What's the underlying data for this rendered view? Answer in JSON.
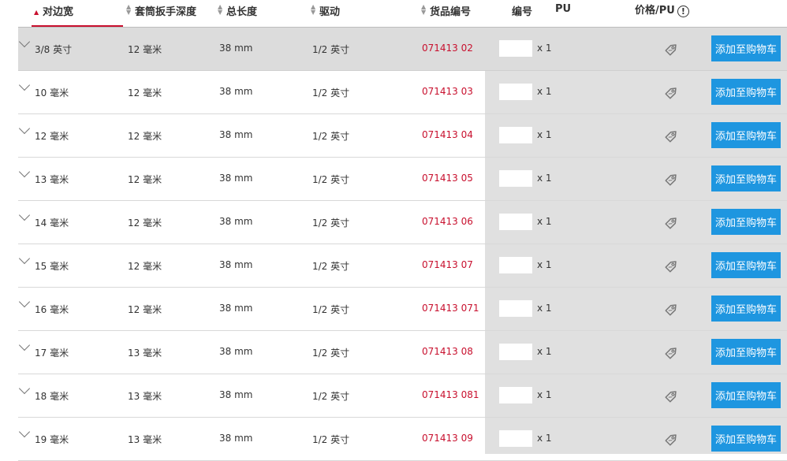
{
  "header": {
    "width_across_flats": "对边宽",
    "socket_depth": "套筒扳手深度",
    "total_length": "总长度",
    "drive": "驱动",
    "article_no": "货品编号",
    "code": "编号",
    "pu": "PU",
    "price_label": "价格/PU",
    "info_symbol": "!"
  },
  "cart_label": "添加至购物车",
  "qty_suffix": "x 1",
  "rows": [
    {
      "size": "3/8 英寸",
      "depth": "12 毫米",
      "length": "38 mm",
      "drive": "1/2 英寸",
      "article": "071413 02"
    },
    {
      "size": "10 毫米",
      "depth": "12 毫米",
      "length": "38 mm",
      "drive": "1/2 英寸",
      "article": "071413 03"
    },
    {
      "size": "12 毫米",
      "depth": "12 毫米",
      "length": "38 mm",
      "drive": "1/2 英寸",
      "article": "071413 04"
    },
    {
      "size": "13 毫米",
      "depth": "12 毫米",
      "length": "38 mm",
      "drive": "1/2 英寸",
      "article": "071413 05"
    },
    {
      "size": "14 毫米",
      "depth": "12 毫米",
      "length": "38 mm",
      "drive": "1/2 英寸",
      "article": "071413 06"
    },
    {
      "size": "15 毫米",
      "depth": "12 毫米",
      "length": "38 mm",
      "drive": "1/2 英寸",
      "article": "071413 07"
    },
    {
      "size": "16 毫米",
      "depth": "12 毫米",
      "length": "38 mm",
      "drive": "1/2 英寸",
      "article": "071413 071"
    },
    {
      "size": "17 毫米",
      "depth": "13 毫米",
      "length": "38 mm",
      "drive": "1/2 英寸",
      "article": "071413 08"
    },
    {
      "size": "18 毫米",
      "depth": "13 毫米",
      "length": "38 mm",
      "drive": "1/2 英寸",
      "article": "071413 081"
    },
    {
      "size": "19 毫米",
      "depth": "13 毫米",
      "length": "38 mm",
      "drive": "1/2 英寸",
      "article": "071413 09"
    }
  ],
  "colors": {
    "accent": "#c8102e",
    "button": "#1e96e0",
    "grey_panel": "#e0e0e0"
  },
  "icons": {
    "sort": "sort-arrows-icon",
    "expand": "chevron-down-icon",
    "price": "price-tag-icon",
    "info": "info-circle-icon"
  }
}
